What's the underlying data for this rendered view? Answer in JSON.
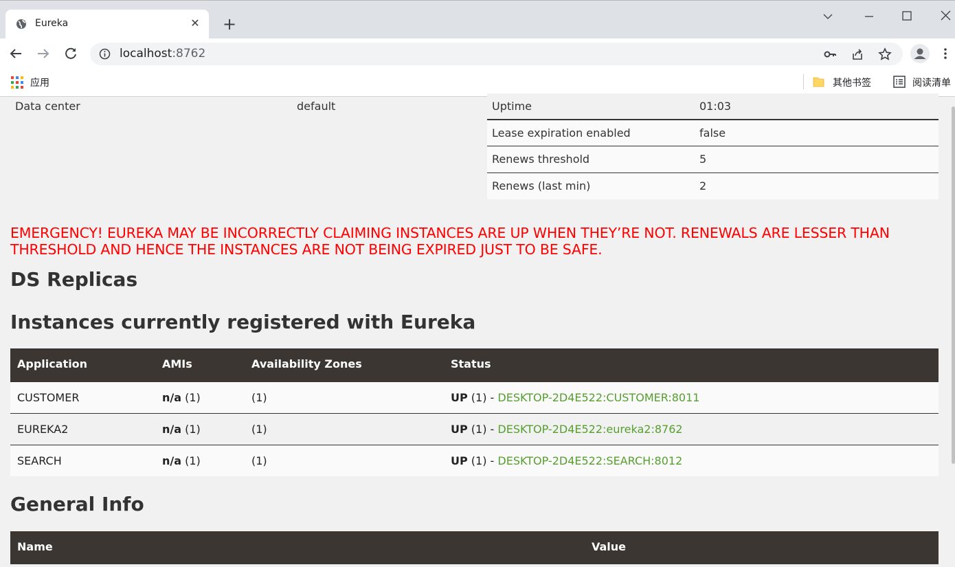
{
  "browser": {
    "tab_title": "Eureka",
    "url_host": "localhost",
    "url_port": ":8762",
    "bookmarks": {
      "apps_label": "应用",
      "other_label": "其他书签",
      "reading_label": "阅读清单"
    }
  },
  "page": {
    "data_center_label": "Data center",
    "data_center_value": "default",
    "stats": [
      {
        "key": "Uptime",
        "value": "01:03"
      },
      {
        "key": "Lease expiration enabled",
        "value": "false"
      },
      {
        "key": "Renews threshold",
        "value": "5"
      },
      {
        "key": "Renews (last min)",
        "value": "2"
      }
    ],
    "emergency": "EMERGENCY! EUREKA MAY BE INCORRECTLY CLAIMING INSTANCES ARE UP WHEN THEY’RE NOT. RENEWALS ARE LESSER THAN THRESHOLD AND HENCE THE INSTANCES ARE NOT BEING EXPIRED JUST TO BE SAFE.",
    "ds_replicas_heading": "DS Replicas",
    "instances_heading": "Instances currently registered with Eureka",
    "instances_columns": [
      "Application",
      "AMIs",
      "Availability Zones",
      "Status"
    ],
    "instances": [
      {
        "application": "CUSTOMER",
        "amis_na": "n/a",
        "amis_count": " (1)",
        "zones": "(1)",
        "status_up": "UP",
        "status_count": " (1) - ",
        "link": "DESKTOP-2D4E522:CUSTOMER:8011"
      },
      {
        "application": "EUREKA2",
        "amis_na": "n/a",
        "amis_count": " (1)",
        "zones": "(1)",
        "status_up": "UP",
        "status_count": " (1) - ",
        "link": "DESKTOP-2D4E522:eureka2:8762"
      },
      {
        "application": "SEARCH",
        "amis_na": "n/a",
        "amis_count": " (1)",
        "zones": "(1)",
        "status_up": "UP",
        "status_count": " (1) - ",
        "link": "DESKTOP-2D4E522:SEARCH:8012"
      }
    ],
    "general_heading": "General Info",
    "general_columns": [
      "Name",
      "Value"
    ]
  },
  "colors": {
    "emergency": "#ff0000",
    "table_header": "#3b3631",
    "link": "#559f2e"
  }
}
